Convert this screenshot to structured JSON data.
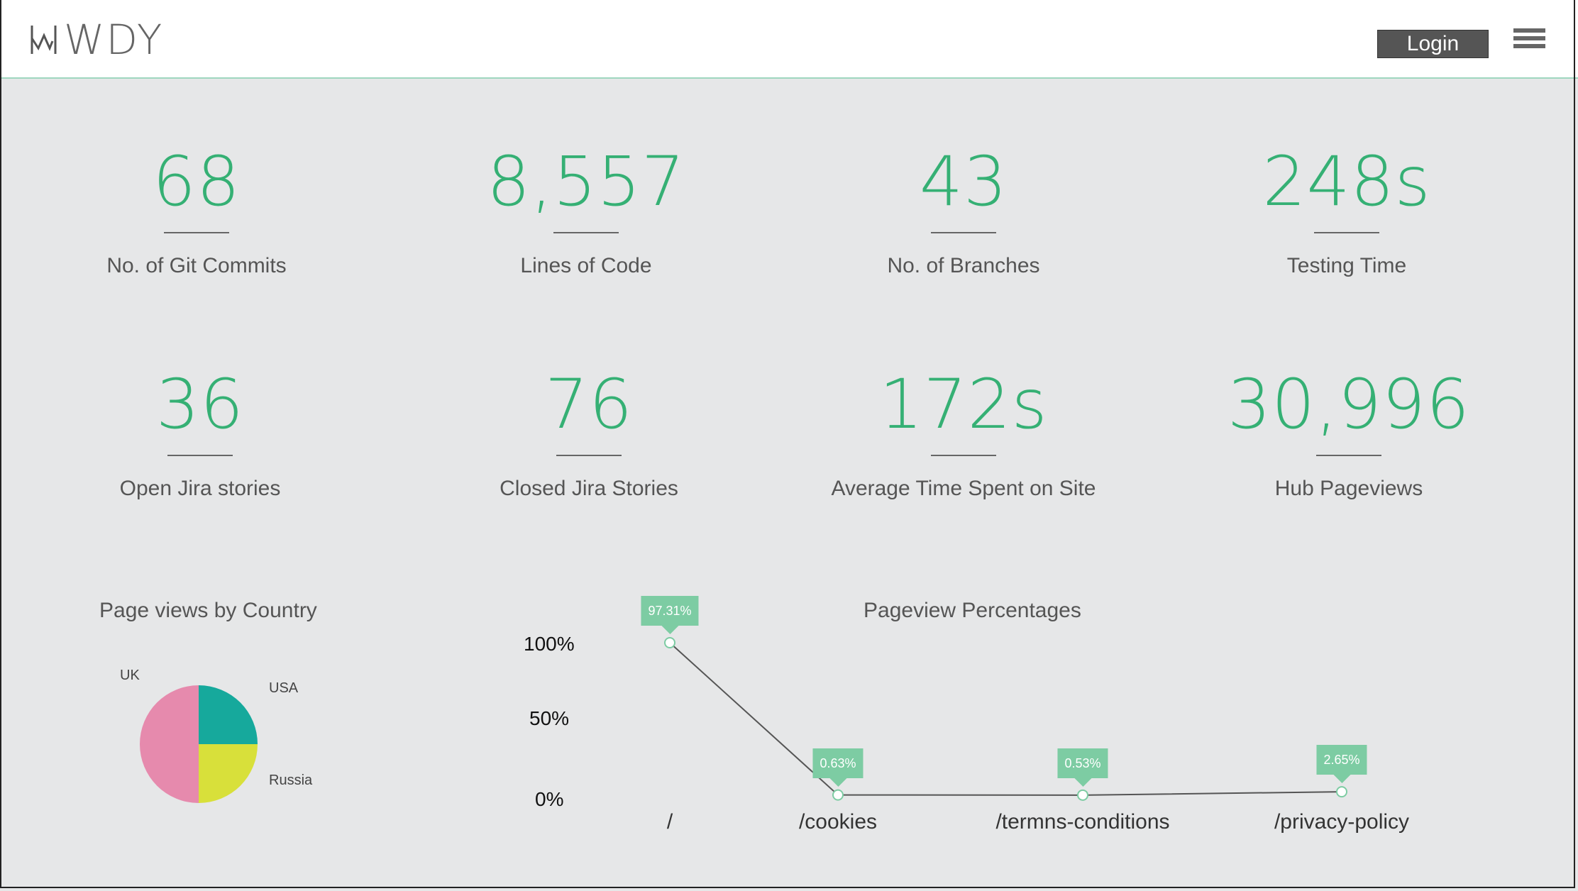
{
  "header": {
    "logo_text": "WDY",
    "login_label": "Login"
  },
  "stats": [
    {
      "value": "68",
      "label": "No. of Git Commits"
    },
    {
      "value": "8,557",
      "label": "Lines of Code"
    },
    {
      "value": "43",
      "label": "No. of Branches"
    },
    {
      "value": "248s",
      "label": "Testing Time"
    },
    {
      "value": "36",
      "label": "Open Jira stories"
    },
    {
      "value": "76",
      "label": "Closed Jira Stories"
    },
    {
      "value": "172s",
      "label": "Average Time Spent on Site"
    },
    {
      "value": "30,996",
      "label": "Hub Pageviews"
    }
  ],
  "pie_panel": {
    "title": "Page views by Country"
  },
  "line_panel": {
    "title": "Pageview Percentages"
  },
  "colors": {
    "accent": "#35b074",
    "tooltip": "#7dcca3",
    "uk": "#e68aad",
    "usa": "#16a99c",
    "russia": "#d8e03a"
  },
  "chart_data": [
    {
      "type": "pie",
      "title": "Page views by Country",
      "slices": [
        {
          "name": "USA",
          "value": 25
        },
        {
          "name": "Russia",
          "value": 25
        },
        {
          "name": "UK",
          "value": 50
        }
      ]
    },
    {
      "type": "line",
      "title": "Pageview Percentages",
      "categories": [
        "/",
        "/cookies",
        "/termns-conditions",
        "/privacy-policy"
      ],
      "values": [
        97.31,
        0.63,
        0.53,
        2.65
      ],
      "data_labels": [
        "97.31%",
        "0.63%",
        "0.53%",
        "2.65%"
      ],
      "y_ticks": [
        "100%",
        "50%",
        "0%"
      ],
      "ylim": [
        0,
        100
      ]
    }
  ]
}
